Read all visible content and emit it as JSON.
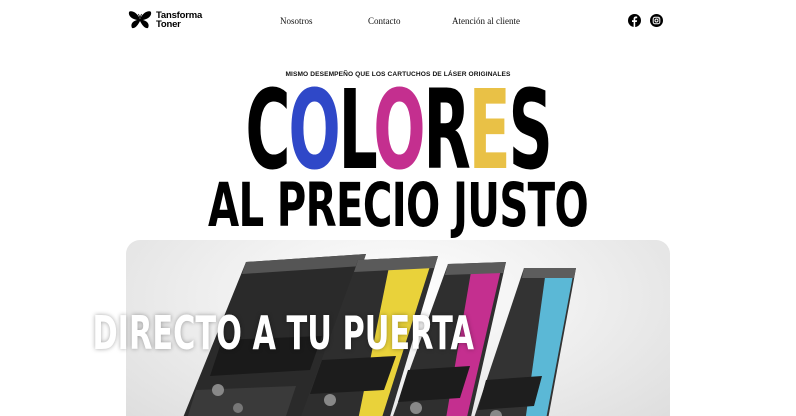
{
  "brand": {
    "line1": "Tansforma",
    "line2": "Toner",
    "logo": "butterfly-logo-icon"
  },
  "nav": [
    {
      "label": "Nosotros"
    },
    {
      "label": "Contacto"
    },
    {
      "label": "Atención al cliente"
    }
  ],
  "social": [
    {
      "icon": "facebook-icon"
    },
    {
      "icon": "instagram-icon"
    }
  ],
  "hero": {
    "tagline": "MISMO DESEMPEÑO QUE LOS CARTUCHOS DE LÁSER ORIGINALES",
    "headline_parts": [
      "C",
      "O",
      "L",
      "O",
      "R",
      "E",
      "S"
    ],
    "subheadline": "AL PRECIO JUSTO",
    "image_caption": "DIRECTO A TU PUERTA"
  },
  "colors": {
    "blue": "#2f48c8",
    "magenta": "#c42f8f",
    "yellow": "#e9c146",
    "cyan": "#5bb8d6",
    "black": "#000000"
  }
}
